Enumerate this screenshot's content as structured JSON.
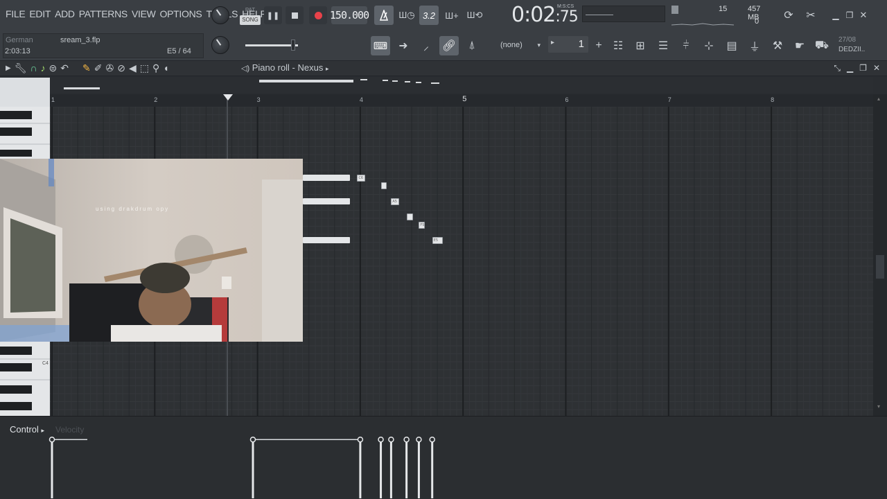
{
  "menu": [
    "FILE",
    "EDIT",
    "ADD",
    "PATTERNS",
    "VIEW",
    "OPTIONS",
    "TOOLS",
    "HELP"
  ],
  "transport": {
    "pat_label": "PAT",
    "song_label": "SONG",
    "tempo": "150.000",
    "time_main": "0:02",
    "time_sub": ":75",
    "time_unit": "M:S:CS"
  },
  "snap": {
    "value": "(none)"
  },
  "pattern_number": "1",
  "cpu": {
    "voices": "15",
    "memory": "457 MB",
    "value2": "0"
  },
  "news": {
    "date": "27/08",
    "text": "DEDZII.."
  },
  "project": {
    "hint": "German",
    "filename": "sream_3.flp",
    "time": "2:03:13",
    "note_info": "E5 / 64"
  },
  "piano_roll": {
    "title": "Piano roll - Nexus",
    "bar_numbers": [
      "1",
      "2",
      "3",
      "4",
      "5",
      "6",
      "7",
      "8"
    ],
    "key_label": "C4",
    "notes": [
      {
        "label": "C6",
        "bar": 3.97,
        "len": 0.08,
        "row": 0
      },
      {
        "label": "",
        "bar": 4.2,
        "len": 0.06,
        "row": 1
      },
      {
        "label": "A5",
        "bar": 4.3,
        "len": 0.08,
        "row": 2
      },
      {
        "label": "",
        "bar": 4.45,
        "len": 0.06,
        "row": 3
      },
      {
        "label": "F5",
        "bar": 4.57,
        "len": 0.06,
        "row": 4
      },
      {
        "label": "E5",
        "bar": 4.7,
        "len": 0.1,
        "row": 5
      }
    ]
  },
  "webcam": {
    "caption": "using drakdrum opy"
  },
  "control": {
    "label": "Control",
    "sub_label": "Velocity",
    "velocity_bars": [
      1.0,
      3.0,
      4.0,
      4.2,
      4.3,
      4.45,
      4.57,
      4.7
    ],
    "velocity_level": 0.8
  }
}
